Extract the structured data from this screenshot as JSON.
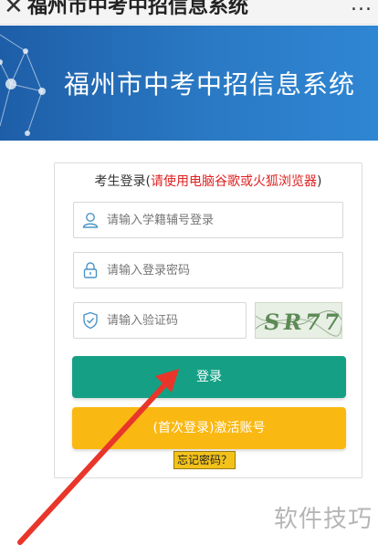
{
  "topbar": {
    "close_glyph": "✕",
    "title": "福州市中考中招信息系统",
    "more_glyph": "..."
  },
  "banner": {
    "title": "福州市中考中招信息系统"
  },
  "login": {
    "header_prefix": "考生登录(",
    "header_warning": "请使用电脑谷歌或火狐浏览器",
    "header_suffix": ")",
    "student_id_placeholder": "请输入学籍辅号登录",
    "password_placeholder": "请输入登录密码",
    "captcha_placeholder": "请输入验证码",
    "captcha_text": "SR77",
    "login_button": "登录",
    "activate_button": "(首次登录)激活账号",
    "forgot_link": "忘记密码？"
  },
  "watermark": "软件技巧",
  "colors": {
    "banner": "#2a79c4",
    "login_button": "#15a085",
    "activate_button": "#fab812",
    "warning_text": "#e02020",
    "annotation_arrow": "#e8362a"
  },
  "icons": {
    "student_id": "user-icon",
    "password": "lock-icon",
    "captcha": "shield-check-icon"
  }
}
